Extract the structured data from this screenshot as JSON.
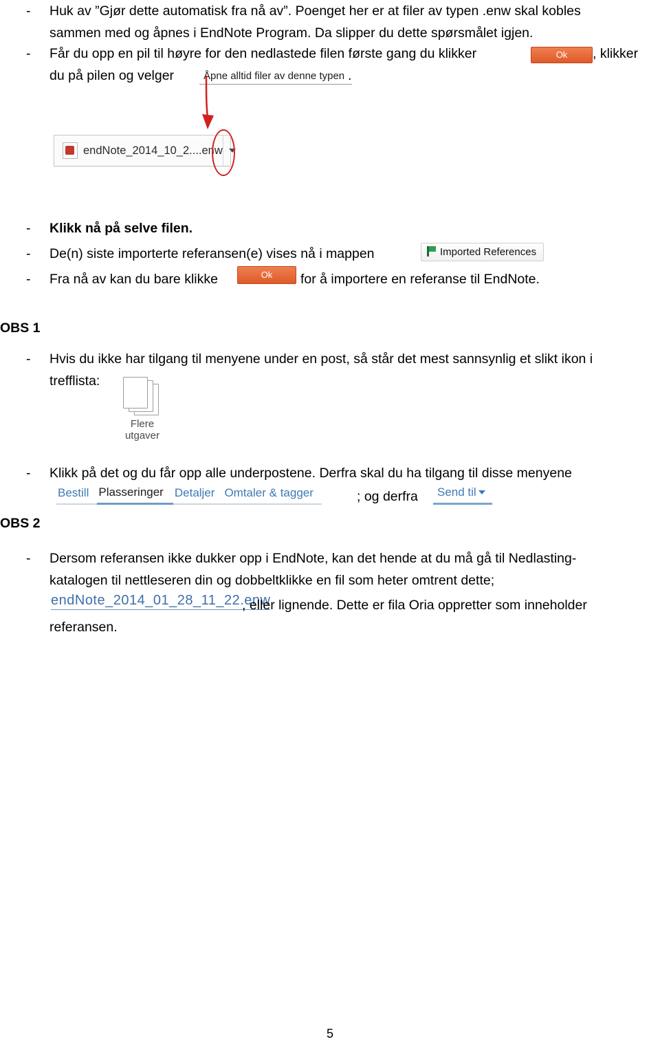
{
  "document": {
    "page_number": "5"
  },
  "bullets": {
    "b1": {
      "marker": "-",
      "line1": "Huk av ”Gjør dette automatisk fra nå av”. Poenget her er at filer av typen .enw skal kobles",
      "line2": "sammen med og åpnes i EndNote Program. Da slipper du dette spørsmålet igjen."
    },
    "b2": {
      "marker": "-",
      "line1_pre": "Får du opp en pil til høyre for den nedlastede filen første gang du klikker",
      "line1_post": ", klikker",
      "line2_pre": "du på pilen og velger",
      "line2_post": "."
    },
    "b3": {
      "marker": "-",
      "text": "Klikk nå på selve filen."
    },
    "b4": {
      "marker": "-",
      "text": "De(n) siste importerte referansen(e) vises nå i mappen"
    },
    "b5": {
      "marker": "-",
      "pre": "Fra nå av kan du bare klikke",
      "post": "for å importere en referanse til EndNote."
    },
    "b6": {
      "marker": "-",
      "line1": "Hvis du ikke har tilgang til menyene under en post, så står det mest sannsynlig et slikt ikon i",
      "line2": "trefflista:"
    },
    "b7": {
      "marker": "-",
      "line1": "Klikk på det og du får opp alle underpostene. Derfra skal du ha tilgang til disse menyene",
      "line2_mid": "; og derfra"
    },
    "b8": {
      "marker": "-",
      "line1": "Dersom referansen ikke dukker opp i EndNote, kan det hende at du må gå til Nedlasting-",
      "line2": "katalogen til nettleseren din og dobbeltklikke en fil som heter omtrent dette;",
      "line3_mid": ", eller lignende. Dette er fila Oria oppretter som inneholder",
      "line4": "referansen."
    }
  },
  "labels": {
    "obs1": "OBS 1",
    "obs2": "OBS 2"
  },
  "widgets": {
    "ok_button_top": "Ok",
    "ok_button_inline": "Ok",
    "open_always_menu": "Åpne alltid filer av denne typen",
    "download_chip_filename": "endNote_2014_10_2....enw",
    "imported_references": "Imported References",
    "flere_utgaver_line1": "Flere",
    "flere_utgaver_line2": "utgaver",
    "tabs": [
      {
        "label": "Bestill",
        "active": false
      },
      {
        "label": "Plasseringer",
        "active": true
      },
      {
        "label": "Detaljer",
        "active": false
      },
      {
        "label": "Omtaler & tagger",
        "active": false
      }
    ],
    "send_til": "Send til",
    "endnote_filename": "endNote_2014_01_28_11_22.enw"
  },
  "colors": {
    "accent_orange": "#e8663c",
    "annotation_red": "#d32020",
    "link_blue": "#3f79b5"
  }
}
